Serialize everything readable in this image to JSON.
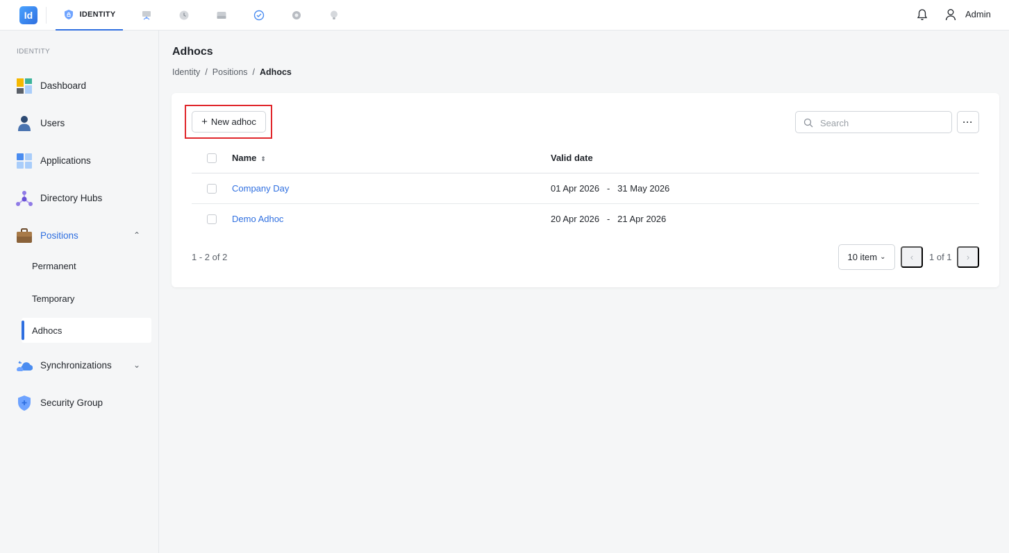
{
  "topbar": {
    "logo_text": "Id",
    "active_app_label": "IDENTITY",
    "app_icons": [
      "monitor-icon",
      "clock-icon",
      "drive-icon",
      "check-badge-icon",
      "gear-icon",
      "bulb-icon"
    ],
    "user_name": "Admin"
  },
  "sidebar": {
    "section_label": "IDENTITY",
    "items": [
      {
        "label": "Dashboard",
        "icon": "dashboard-icon"
      },
      {
        "label": "Users",
        "icon": "user-icon"
      },
      {
        "label": "Applications",
        "icon": "applications-icon"
      },
      {
        "label": "Directory Hubs",
        "icon": "hub-icon"
      },
      {
        "label": "Positions",
        "icon": "briefcase-icon",
        "expanded": true
      },
      {
        "label": "Synchronizations",
        "icon": "cloud-sync-icon",
        "expanded": false
      },
      {
        "label": "Security Group",
        "icon": "shield-icon"
      }
    ],
    "positions_sub": [
      "Permanent",
      "Temporary",
      "Adhocs"
    ],
    "active_sub": "Adhocs"
  },
  "page": {
    "title": "Adhocs",
    "breadcrumb": [
      "Identity",
      "Positions",
      "Adhocs"
    ]
  },
  "toolbar": {
    "new_label": "New adhoc",
    "search_placeholder": "Search",
    "more_label": "···"
  },
  "table": {
    "columns": [
      "Name",
      "Valid date"
    ],
    "rows": [
      {
        "name": "Company Day",
        "valid_date": "01 Apr 2026   -   31 May 2026"
      },
      {
        "name": "Demo Adhoc",
        "valid_date": "20 Apr 2026   -   21 Apr 2026"
      }
    ]
  },
  "pagination": {
    "range": "1 - 2 of 2",
    "page_size": "10 item",
    "page_label": "1 of 1"
  },
  "colors": {
    "accent": "#2f6fe0",
    "highlight": "#e0262b"
  }
}
